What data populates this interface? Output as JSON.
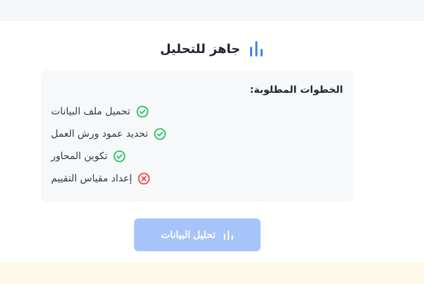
{
  "header": {
    "title": "جاهز للتحليل",
    "icon": "bar-chart-icon",
    "icon_color": "#3b82f6"
  },
  "steps": {
    "title": "الخطوات المطلوبة:",
    "items": [
      {
        "label": "تحميل ملف البيانات",
        "status": "complete",
        "icon": "check-circle-icon"
      },
      {
        "label": "تحديد عمود ورش العمل",
        "status": "complete",
        "icon": "check-circle-icon"
      },
      {
        "label": "تكوين المحاور",
        "status": "complete",
        "icon": "check-circle-icon"
      },
      {
        "label": "إعداد مقياس التقييم",
        "status": "incomplete",
        "icon": "x-circle-icon"
      }
    ]
  },
  "action": {
    "label": "تحليل البيانات",
    "icon": "bar-chart-icon",
    "disabled": true
  },
  "colors": {
    "success": "#22c55e",
    "error": "#ef4444",
    "button_bg": "#a6c4f9",
    "accent": "#3b82f6"
  }
}
